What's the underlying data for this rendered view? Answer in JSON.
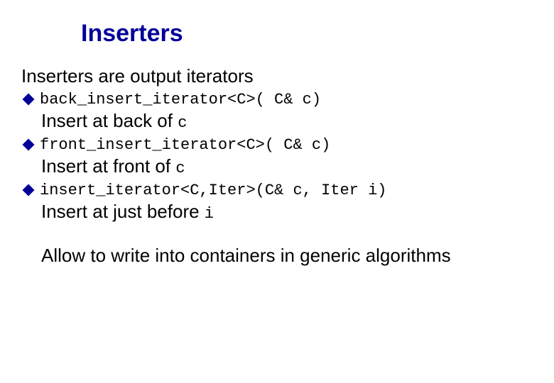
{
  "title": "Inserters",
  "intro": "Inserters are output iterators",
  "items": [
    {
      "code": "back_insert_iterator<C>( C& c)",
      "desc_prefix": "Insert at back of ",
      "desc_code": "c"
    },
    {
      "code": "front_insert_iterator<C>( C& c)",
      "desc_prefix": "Insert at front of ",
      "desc_code": "c"
    },
    {
      "code": "insert_iterator<C,Iter>(C& c, Iter i)",
      "desc_prefix": "Insert at just before ",
      "desc_code": "i"
    }
  ],
  "closing": "Allow to write into containers in generic algorithms"
}
